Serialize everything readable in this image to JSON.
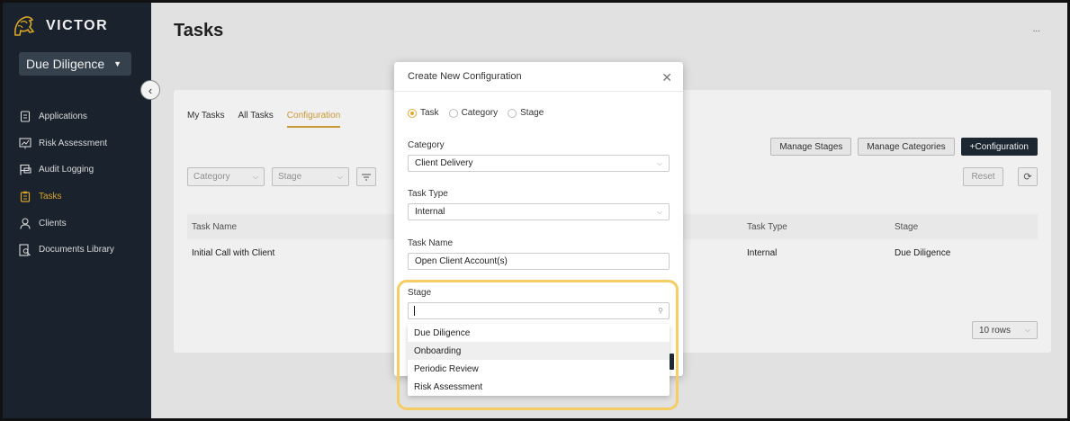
{
  "sidebar": {
    "logo_text": "VICTOR",
    "workspace": "Due Diligence",
    "items": [
      {
        "label": "Applications",
        "icon": "document-icon"
      },
      {
        "label": "Risk Assessment",
        "icon": "chart-icon"
      },
      {
        "label": "Audit Logging",
        "icon": "flag-icon"
      },
      {
        "label": "Tasks",
        "icon": "clipboard-icon",
        "active": true
      },
      {
        "label": "Clients",
        "icon": "user-icon"
      },
      {
        "label": "Documents Library",
        "icon": "doc-search-icon"
      }
    ]
  },
  "header": {
    "title": "Tasks",
    "more": "..."
  },
  "tabs": [
    "My Tasks",
    "All Tasks",
    "Configuration"
  ],
  "toolbar": {
    "manage_stages": "Manage Stages",
    "manage_categories": "Manage Categories",
    "add_configuration": "+Configuration"
  },
  "filters": {
    "category_placeholder": "Category",
    "stage_placeholder": "Stage",
    "reset": "Reset"
  },
  "table": {
    "columns": [
      "Task Name",
      "Task Type",
      "Stage"
    ],
    "rows": [
      {
        "task_name": "Initial Call with Client",
        "task_type": "Internal",
        "stage": "Due Diligence"
      }
    ]
  },
  "pagination": {
    "rows_label": "10 rows"
  },
  "modal": {
    "title": "Create New Configuration",
    "radios": [
      {
        "label": "Task",
        "selected": true
      },
      {
        "label": "Category",
        "selected": false
      },
      {
        "label": "Stage",
        "selected": false
      }
    ],
    "category_label": "Category",
    "category_value": "Client Delivery",
    "task_type_label": "Task Type",
    "task_type_value": "Internal",
    "task_name_label": "Task Name",
    "task_name_value": "Open Client Account(s)",
    "stage_label": "Stage",
    "stage_search_value": "",
    "stage_options": [
      "Due Diligence",
      "Onboarding",
      "Periodic Review",
      "Risk Assessment"
    ],
    "hovered_option": "Onboarding"
  },
  "colors": {
    "sidebar_bg": "#1c2530",
    "accent": "#d7a33b",
    "highlight": "#f5cd63",
    "primary_button": "#1f2a36"
  }
}
